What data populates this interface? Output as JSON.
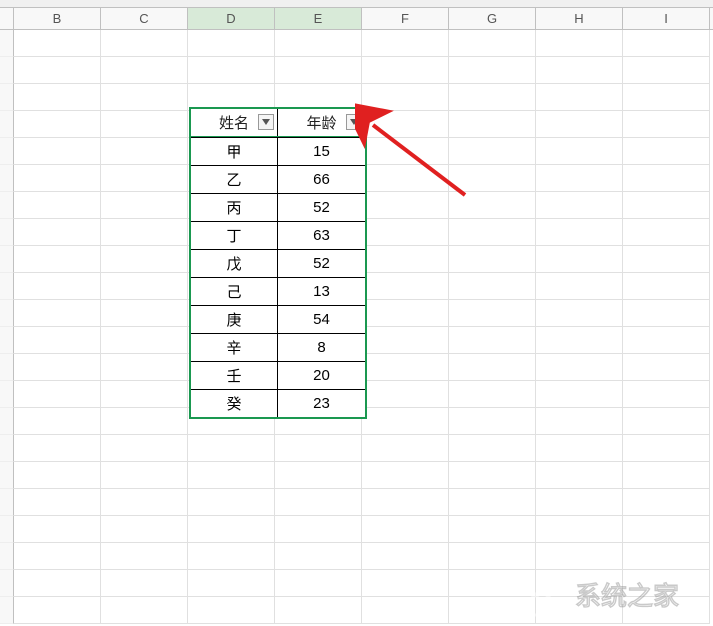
{
  "columns": [
    "B",
    "C",
    "D",
    "E",
    "F",
    "G",
    "H",
    "I"
  ],
  "selected_columns": [
    "D",
    "E"
  ],
  "table": {
    "headers": {
      "name": "姓名",
      "age": "年龄"
    }
  },
  "chart_data": {
    "type": "table",
    "columns": [
      "姓名",
      "年龄"
    ],
    "rows": [
      {
        "name": "甲",
        "age": 15
      },
      {
        "name": "乙",
        "age": 66
      },
      {
        "name": "丙",
        "age": 52
      },
      {
        "name": "丁",
        "age": 63
      },
      {
        "name": "戊",
        "age": 52
      },
      {
        "name": "己",
        "age": 13
      },
      {
        "name": "庚",
        "age": 54
      },
      {
        "name": "辛",
        "age": 8
      },
      {
        "name": "壬",
        "age": 20
      },
      {
        "name": "癸",
        "age": 23
      }
    ]
  },
  "watermark": "系统之家"
}
